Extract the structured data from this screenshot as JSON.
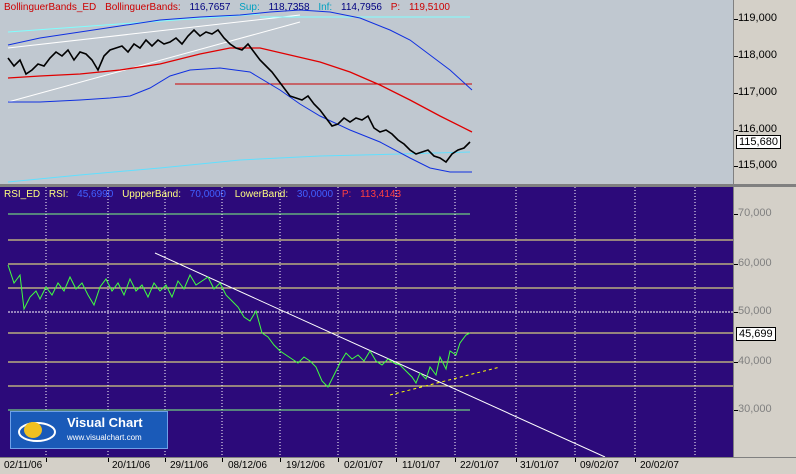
{
  "top_legend": {
    "indicator": "BollinguerBands_ED",
    "name": "BollinguerBands:",
    "value": "116,7657",
    "sup_label": "Sup:",
    "sup_value": "118,7358",
    "inf_label": "Inf:",
    "inf_value": "114,7956",
    "p_label": "P:",
    "p_value": "119,5100"
  },
  "top_axis": {
    "ticks": [
      "119,000",
      "118,000",
      "117,000",
      "116,000",
      "115,000"
    ],
    "current_price": "115,680"
  },
  "bottom_legend": {
    "indicator": "RSI_ED",
    "name": "RSI:",
    "value": "45,6990",
    "upper_label": "UppperBand:",
    "upper_value": "70,0000",
    "lower_label": "LowerBand:",
    "lower_value": "30,0000",
    "p_label": "P:",
    "p_value": "113,4143"
  },
  "bottom_axis": {
    "ticks": [
      "70,000",
      "60,000",
      "50,000",
      "40,000",
      "30,000"
    ],
    "current_value": "45,699"
  },
  "x_axis": {
    "dates": [
      "02/11/06",
      "20/11/06",
      "29/11/06",
      "08/12/06",
      "19/12/06",
      "02/01/07",
      "11/01/07",
      "22/01/07",
      "31/01/07",
      "09/02/07",
      "20/02/07"
    ]
  },
  "logo": {
    "title": "Visual Chart",
    "url": "www.visualchart.com"
  },
  "colors": {
    "top_bg": "#c0c8d0",
    "bottom_bg": "#2c0a7a",
    "price_bars": "#000000",
    "middle_band": "#ff0000",
    "bollinger_bands": "#1030e0",
    "rsi_line": "#40ff40",
    "level_lines": "#ffff80"
  }
}
